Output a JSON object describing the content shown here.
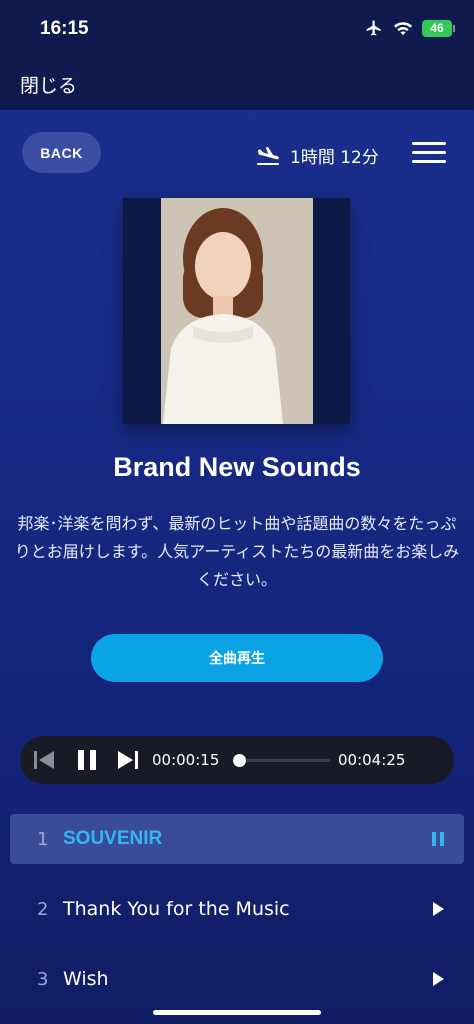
{
  "status_bar": {
    "time": "16:15",
    "battery": "46",
    "icons": [
      "airplane-icon",
      "wifi-icon",
      "battery-icon"
    ]
  },
  "nav": {
    "close_label": "閉じる"
  },
  "header": {
    "back_label": "BACK",
    "flight_time": "1時間 12分",
    "flight_icon": "landing-plane-icon",
    "menu_icon": "hamburger-menu-icon"
  },
  "playlist": {
    "title": "Brand New Sounds",
    "description": "邦楽･洋楽を問わず、最新のヒット曲や話題曲の数々をたっぷりとお届けします。人気アーティストたちの最新曲をお楽しみください。",
    "play_all_label": "全曲再生"
  },
  "player": {
    "elapsed": "00:00:15",
    "total": "00:04:25",
    "progress_fraction": 0.057,
    "controls": [
      "previous-track-icon",
      "pause-icon",
      "next-track-icon"
    ]
  },
  "tracks": [
    {
      "number": "1",
      "title": "SOUVENIR",
      "state": "playing",
      "icon": "pause-icon"
    },
    {
      "number": "2",
      "title": "Thank You for the Music",
      "state": "idle",
      "icon": "play-icon"
    },
    {
      "number": "3",
      "title": "Wish",
      "state": "idle",
      "icon": "play-icon"
    }
  ],
  "colors": {
    "background": "#1b2f8e",
    "accent": "#0aa3e6",
    "active_track_text": "#33b6f2",
    "player_bar": "#181a26"
  }
}
